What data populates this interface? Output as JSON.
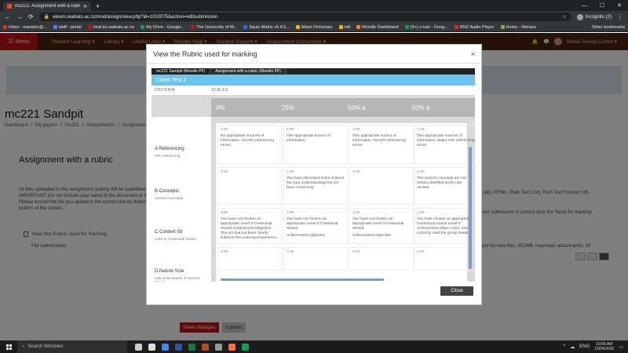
{
  "browser": {
    "tab_title": "mc221: Assignment with a rubric",
    "new_tab": "+",
    "url": "elearn.waikato.ac.nz/mod/assign/view.php?id=1010075&action=editsubmission",
    "profile": "Incognito (2)",
    "window_buttons": [
      "—",
      "☐",
      "✕"
    ],
    "nav_icons": [
      "←",
      "→",
      "⟳"
    ],
    "bookmarks": [
      {
        "label": "Inbox - manater@...",
        "color": "#d93025"
      },
      {
        "label": "staff - portal",
        "color": "#4285f4"
      },
      {
        "label": "heat.its.waikato.ac.nz",
        "color": "#c21418"
      },
      {
        "label": "My Drive - Google...",
        "color": "#0f9d58"
      },
      {
        "label": "The University of W...",
        "color": "#c21418"
      },
      {
        "label": "Squiz Matrix v5.4.5...",
        "color": "#1a73e8"
      },
      {
        "label": "Māori Dictionary",
        "color": "#f4b400"
      },
      {
        "label": "odt",
        "color": "#f4b400"
      },
      {
        "label": "Moodle Dashboard",
        "color": "#f98012"
      },
      {
        "label": "(9+) e-tuts - Goog...",
        "color": "#0f9d58"
      },
      {
        "label": "RNZ Audio Player",
        "color": "#d93025"
      },
      {
        "label": "Home - Mahara",
        "color": "#7cb342"
      }
    ],
    "other_bookmarks": "Other bookmarks"
  },
  "navbar": {
    "menu_label": "Menu",
    "items": [
      "Student Learning ▾",
      "Library ▾",
      "Useful Links ▾",
      "Moodle Help ▾",
      "Student Support ▾",
      "Assessment Instructions ▾"
    ],
    "user_name": "Maria-Teresa Corino ▾"
  },
  "page": {
    "title": "mc221 Sandpit",
    "breadcrumbs": [
      "Dashboard",
      "/",
      "My papers",
      "/",
      "mc221",
      "/",
      "Assessments",
      "/",
      "Assignment with a rubric"
    ],
    "assignment_title": "Assignment with a rubric",
    "body_text": "All files uploaded to this assignment activity will be submitted IMPORTANT (Do not include your name in the document or PDF) Please ensure the file you upload is the correct one by button at the bottom of the screen.",
    "file_types": "(.odt), HTML, Plain Text (.txt), Rich Text Format (.rtf)",
    "submit_note": "your submission is correct click the 'Send for marking'",
    "view_rubric_link": "View the Rubric used for marking",
    "file_submissions": "File submissions",
    "max_size": "size for new files: 301MB, maximum attachments: 20",
    "save_button": "Save changes",
    "cancel_button": "Cancel"
  },
  "modal": {
    "title": "View the Rubric used for marking",
    "close_x": "×",
    "tabs": [
      "mc221 Sandpit (Moodle PF)",
      "Assignment with a rubric (Moodle PF)"
    ],
    "rubric_title": "Client Test 2",
    "col_criteria": "CRITERIA",
    "col_scales": "SCALES",
    "levels": [
      "0%",
      "25%",
      "50% a",
      "50% b"
    ],
    "criteria": [
      {
        "name": "A Referencing",
        "desc": "APA referencing",
        "cells": [
          {
            "score": "0.00",
            "text": "No appropriate sources of information. No APA referencing errors"
          },
          {
            "score": "0.50",
            "text": "One appropriate source of information"
          },
          {
            "score": "1.00",
            "text": "One appropriate source of information. No APA referencing errors"
          },
          {
            "score": "1.00",
            "text": "Two appropriate sources of information. Major APA referencing errors"
          }
        ]
      },
      {
        "name": "B Concepts",
        "desc": "Science Concepts",
        "cells": [
          {
            "score": "0.00",
            "text": ""
          },
          {
            "score": "1.00",
            "text": "You have discussed some science but your understanding has not been convincing"
          },
          {
            "score": "2.00",
            "text": ""
          },
          {
            "score": "2.00",
            "text": "The science concepts are not clearly identified and/or are unclear"
          }
        ]
      },
      {
        "name": "C Context Str",
        "desc": "Links to Contextual Strand",
        "cells": [
          {
            "score": "0.00",
            "text": "You have not chosen an appropriate Level 3 Contextual Strand Achievement Objective. The AO has not been clearly linked to the Learning Experience.",
            "note": ""
          },
          {
            "score": "0.50",
            "text": "You have not chosen an appropriate Level 3 Contextual Strand",
            "note": "Achievement Objective"
          },
          {
            "score": "1.00",
            "text": "You have not chosen an appropriate Level 3 Contextual Strand",
            "note": "Achievement Objective"
          },
          {
            "score": "1.50",
            "text": "You have chosen an appropriate Contextual Strand Level 3 Achievement Object (AO), and correctly cited the group heading",
            "note": ""
          }
        ]
      },
      {
        "name": "D Nature Scie",
        "desc": "Link to the Nature of Science Strand",
        "cells": [
          {
            "score": "0.00",
            "text": ""
          },
          {
            "score": "0.00",
            "text": ""
          },
          {
            "score": "0.00",
            "text": ""
          },
          {
            "score": "0.00",
            "text": ""
          }
        ]
      }
    ],
    "close_button": "Close"
  },
  "taskbar": {
    "search": "Search Windows",
    "app_colors": [
      "#ccc",
      "#ddd",
      "#4285f4",
      "#2b579a",
      "#217346",
      "#b7472a",
      "#999",
      "#ff7139",
      "#0f9d58"
    ],
    "tray_icons": [
      "^",
      "☁",
      "ENG"
    ],
    "time": "10:56 AM",
    "date": "15/04/2020"
  },
  "colors": {
    "accent_red": "#c21418",
    "navbar_brown": "#4a2410",
    "rubric_blue": "#6cc4ee"
  }
}
